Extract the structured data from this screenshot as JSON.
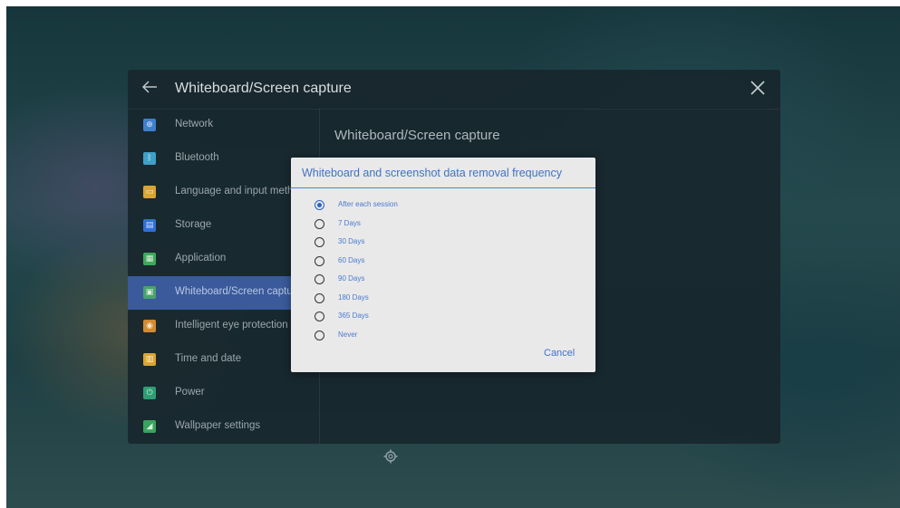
{
  "header": {
    "title": "Whiteboard/Screen capture",
    "back_icon": "back-arrow-icon",
    "close_icon": "close-icon"
  },
  "sidebar": {
    "items": [
      {
        "label": "Network",
        "icon": "globe-icon",
        "color": "#3f7fd0"
      },
      {
        "label": "Bluetooth",
        "icon": "bluetooth-icon",
        "color": "#3fa0c9"
      },
      {
        "label": "Language and input metho",
        "icon": "keyboard-icon",
        "color": "#d9a534"
      },
      {
        "label": "Storage",
        "icon": "storage-icon",
        "color": "#2f6fd8"
      },
      {
        "label": "Application",
        "icon": "apps-icon",
        "color": "#3fa85a"
      },
      {
        "label": "Whiteboard/Screen capture",
        "icon": "screen-capture-icon",
        "color": "#4aa36a",
        "active": true
      },
      {
        "label": "Intelligent eye protection",
        "icon": "eye-icon",
        "color": "#d48a2e"
      },
      {
        "label": "Time and date",
        "icon": "calendar-icon",
        "color": "#d9a534"
      },
      {
        "label": "Power",
        "icon": "power-icon",
        "color": "#2f9e73"
      },
      {
        "label": "Wallpaper settings",
        "icon": "wallpaper-icon",
        "color": "#39a45d"
      }
    ]
  },
  "content": {
    "title": "Whiteboard/Screen capture"
  },
  "dialog": {
    "title": "Whiteboard and screenshot data removal frequency",
    "options": [
      {
        "label": "After each session",
        "selected": true
      },
      {
        "label": "7 Days",
        "selected": false
      },
      {
        "label": "30 Days",
        "selected": false
      },
      {
        "label": "60 Days",
        "selected": false
      },
      {
        "label": "90 Days",
        "selected": false
      },
      {
        "label": "180 Days",
        "selected": false
      },
      {
        "label": "365 Days",
        "selected": false
      },
      {
        "label": "Never",
        "selected": false
      }
    ],
    "cancel_label": "Cancel"
  },
  "colors": {
    "accent": "#3e73c7",
    "active_row": "#3a5a9c",
    "dialog_bg": "#e9e9e9"
  }
}
